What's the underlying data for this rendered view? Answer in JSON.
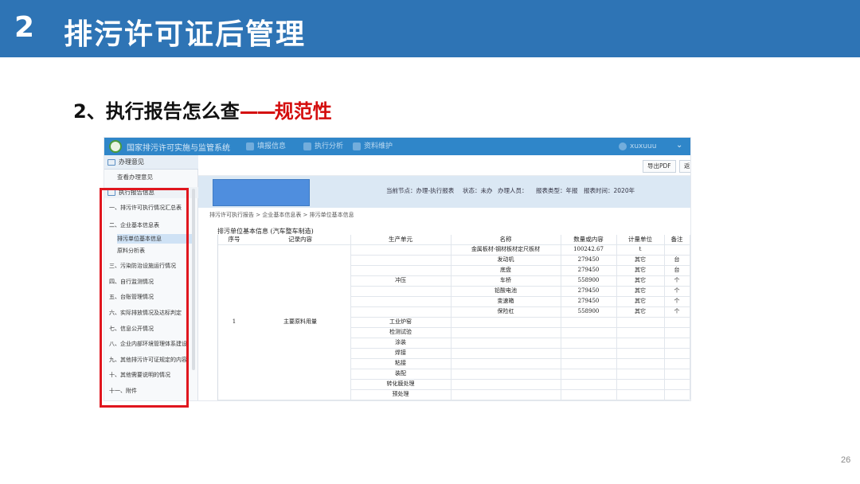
{
  "slide": {
    "number": "2",
    "title": "排污许可证后管理",
    "page_number": "26",
    "header_color": "#2e74b5"
  },
  "subtitle": {
    "main": "2、执行报告怎么查",
    "dash": "——",
    "accent": "规范性",
    "accent_color": "#d40d0d"
  },
  "app": {
    "system_title": "国家排污许可实施与监管系统",
    "nav": [
      "填报信息",
      "执行分析",
      "资料维护"
    ],
    "user": "xuxuuu",
    "toolbar": {
      "export_pdf": "导出PDF",
      "back": "返"
    },
    "sidebar": {
      "header": "办理意见",
      "view_opinion": "查看办理意见",
      "section": "执行报告信息",
      "items": [
        {
          "label": "一、排污许可执行情况汇总表"
        },
        {
          "label": "二、企业基本信息表"
        },
        {
          "label": "排污单位基本信息"
        },
        {
          "label": "原料分析表"
        },
        {
          "label": "三、污染防治设施运行情况"
        },
        {
          "label": "四、自行监测情况"
        },
        {
          "label": "五、台账管理情况"
        },
        {
          "label": "六、实际排放情况及达标判定"
        },
        {
          "label": "七、信息公开情况"
        },
        {
          "label": "八、企业内部环境管理体系建设"
        },
        {
          "label": "九、其他排污许可证规定的内容"
        },
        {
          "label": "十、其他需要说明的情况"
        },
        {
          "label": "十一、附件"
        }
      ]
    },
    "info": {
      "node": "当前节点：办理-执行报表",
      "status": "状态：未办",
      "handler": "办理人员：",
      "report_type": "报表类型：年报",
      "report_time": "报表时间：2020年"
    },
    "breadcrumb": "排污许可执行报告 > 企业基本信息表 > 排污单位基本信息",
    "table": {
      "caption": "排污单位基本信息 (汽车整车制造)",
      "headers": [
        "序号",
        "记录内容",
        "生产单元",
        "名称",
        "数量或内容",
        "计量单位",
        "备注"
      ],
      "row_index": "1",
      "record_content": "主要原料用量",
      "stamping_unit": "冲压",
      "materials": [
        {
          "name": "金属板材-钢材板材定尺板材",
          "qty": "100242.67",
          "unit": "t",
          "note": ""
        },
        {
          "name": "发动机",
          "qty": "279450",
          "unit": "其它",
          "note": "台"
        },
        {
          "name": "底盘",
          "qty": "279450",
          "unit": "其它",
          "note": "台"
        },
        {
          "name": "车桥",
          "qty": "558900",
          "unit": "其它",
          "note": "个"
        },
        {
          "name": "铅酸电池",
          "qty": "279450",
          "unit": "其它",
          "note": "个"
        },
        {
          "name": "变速箱",
          "qty": "279450",
          "unit": "其它",
          "note": "个"
        },
        {
          "name": "保险杠",
          "qty": "558900",
          "unit": "其它",
          "note": "个"
        }
      ],
      "other_units": [
        "工业炉窑",
        "检测试验",
        "涂装",
        "焊接",
        "粘接",
        "装配",
        "转化膜处理",
        "预处理"
      ]
    }
  }
}
